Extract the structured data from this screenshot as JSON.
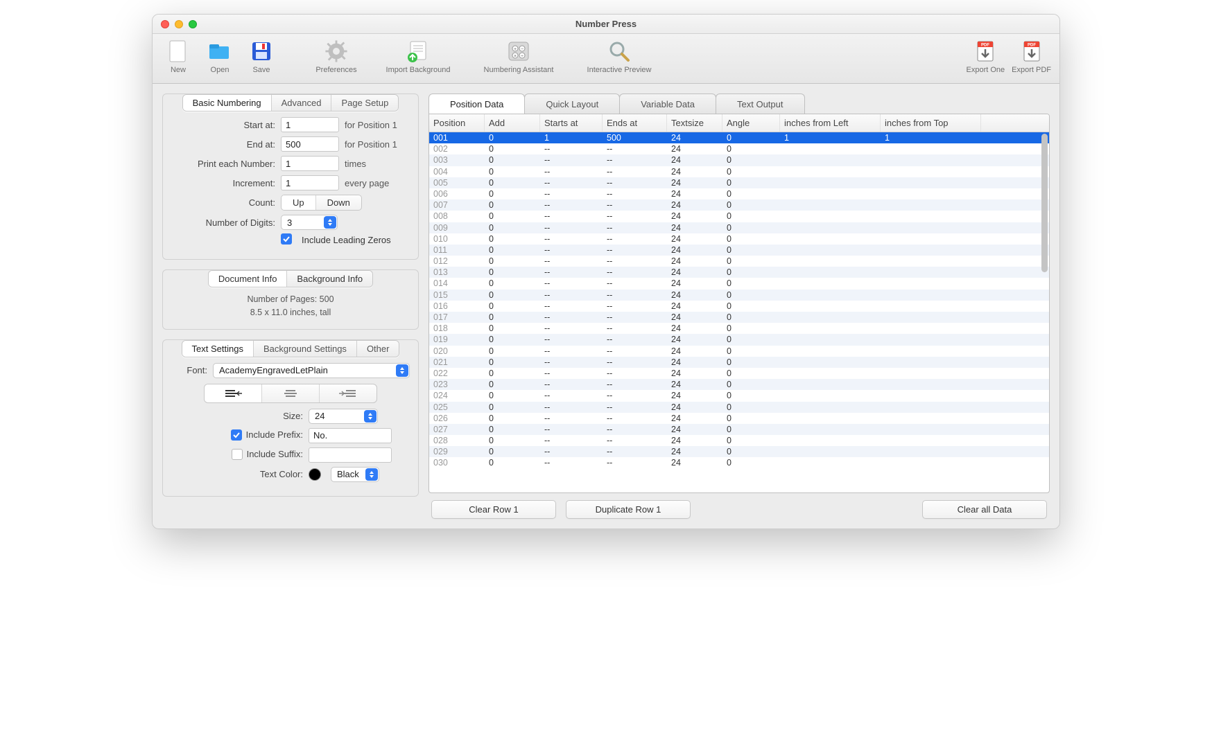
{
  "window": {
    "title": "Number Press"
  },
  "toolbar": {
    "left": [
      {
        "name": "new",
        "label": "New"
      },
      {
        "name": "open",
        "label": "Open"
      },
      {
        "name": "save",
        "label": "Save"
      }
    ],
    "mid": [
      {
        "name": "preferences",
        "label": "Preferences"
      },
      {
        "name": "import-bg",
        "label": "Import Background"
      },
      {
        "name": "num-assist",
        "label": "Numbering Assistant"
      },
      {
        "name": "preview",
        "label": "Interactive Preview"
      }
    ],
    "right": [
      {
        "name": "export-one",
        "label": "Export One"
      },
      {
        "name": "export-pdf",
        "label": "Export PDF"
      }
    ]
  },
  "left_tabs": {
    "basic": "Basic Numbering",
    "advanced": "Advanced",
    "page_setup": "Page Setup"
  },
  "form": {
    "start_at_label": "Start at:",
    "start_at_value": "1",
    "start_at_suffix": "for Position 1",
    "end_at_label": "End at:",
    "end_at_value": "500",
    "end_at_suffix": "for Position 1",
    "print_each_label": "Print each Number:",
    "print_each_value": "1",
    "print_each_suffix": "times",
    "increment_label": "Increment:",
    "increment_value": "1",
    "increment_suffix": "every page",
    "count_label": "Count:",
    "count_up": "Up",
    "count_down": "Down",
    "digits_label": "Number of Digits:",
    "digits_value": "3",
    "leading_zeros_label": "Include Leading Zeros"
  },
  "info_tabs": {
    "doc": "Document Info",
    "bg": "Background Info"
  },
  "doc_info": {
    "pages": "Number of Pages: 500",
    "size": "8.5 x 11.0 inches, tall"
  },
  "settings_tabs": {
    "text": "Text Settings",
    "bg": "Background Settings",
    "other": "Other"
  },
  "text_settings": {
    "font_label": "Font:",
    "font_value": "AcademyEngravedLetPlain",
    "size_label": "Size:",
    "size_value": "24",
    "include_prefix_label": "Include Prefix:",
    "prefix_value": "No.",
    "include_suffix_label": "Include Suffix:",
    "suffix_value": "",
    "text_color_label": "Text Color:",
    "text_color_name": "Black",
    "text_color_hex": "#000000"
  },
  "right_tabs": {
    "position": "Position Data",
    "quick": "Quick Layout",
    "variable": "Variable Data",
    "textout": "Text Output"
  },
  "table": {
    "columns": [
      "Position",
      "Add",
      "Starts at",
      "Ends at",
      "Textsize",
      "Angle",
      "inches from Left",
      "inches from Top"
    ],
    "first_row": [
      "001",
      "0",
      "1",
      "500",
      "24",
      "0",
      "1",
      "1"
    ],
    "row_count": 30,
    "default_cells": [
      "",
      "0",
      "--",
      "--",
      "24",
      "0",
      "",
      ""
    ]
  },
  "buttons": {
    "clear_row": "Clear Row 1",
    "dup_row": "Duplicate Row 1",
    "clear_all": "Clear all Data"
  }
}
